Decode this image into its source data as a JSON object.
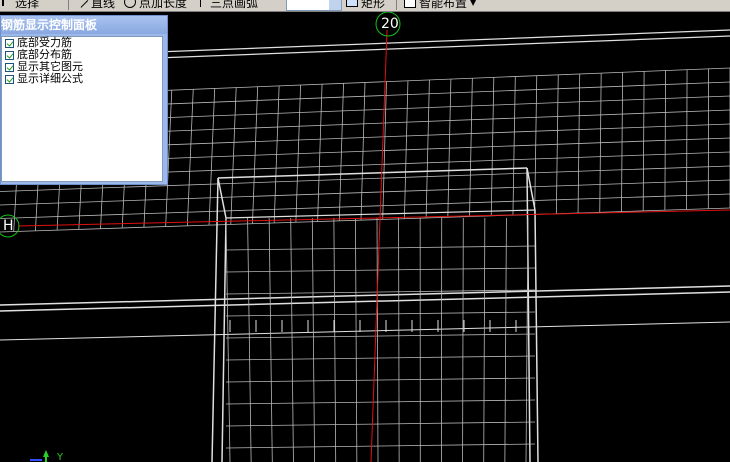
{
  "toolbar": {
    "select_label": "选择",
    "line_label": "直线",
    "point_length_label": "点加长度",
    "three_point_arc_label": "三点画弧",
    "rect_label": "矩形",
    "smart_layout_label": "智能布置"
  },
  "panel": {
    "title": "钢筋显示控制面板",
    "options": [
      {
        "label": "底部受力筋",
        "checked": true
      },
      {
        "label": "底部分布筋",
        "checked": true
      },
      {
        "label": "显示其它图元",
        "checked": true
      },
      {
        "label": "显示详细公式",
        "checked": true
      }
    ]
  },
  "axes": {
    "vertical_axis_label": "20",
    "horizontal_axis_label": "H"
  },
  "colors": {
    "axis_line": "#e01010",
    "axis_bubble": "#16c016",
    "grid_line": "#b8b8b8",
    "wireframe": "#e0e0e0",
    "ucs_x": "#2ad02a",
    "ucs_y": "#3050ff"
  }
}
